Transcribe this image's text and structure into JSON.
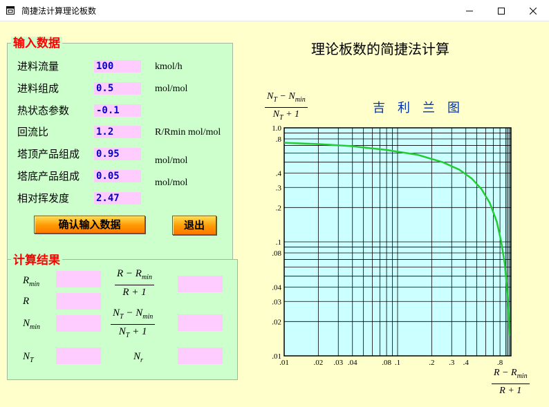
{
  "window": {
    "title": "简捷法计算理论板数"
  },
  "input_frame": {
    "title": "输入数据",
    "rows": [
      {
        "label": "进料流量",
        "value": "100",
        "unit": "kmol/h"
      },
      {
        "label": "进料组成",
        "value": "0.5",
        "unit": "mol/mol"
      },
      {
        "label": "热状态参数",
        "value": "-0.1",
        "unit": ""
      },
      {
        "label": "回流比",
        "value": "1.2",
        "unit": "R/Rmin mol/mol"
      },
      {
        "label": "塔顶产品组成",
        "value": "0.95",
        "unit": "mol/mol"
      },
      {
        "label": "塔底产品组成",
        "value": "0.05",
        "unit": "mol/mol"
      },
      {
        "label": "相对挥发度",
        "value": "2.47",
        "unit": ""
      }
    ],
    "confirm_label": "确认输入数据",
    "exit_label": "退出"
  },
  "result_frame": {
    "title": "计算结果",
    "labels": {
      "rmin": "R",
      "rmin_sub": "min",
      "r": "R",
      "nmin": "N",
      "nmin_sub": "min",
      "nt": "N",
      "nt_sub": "T",
      "nr": "N",
      "nr_sub": "r"
    },
    "frac1": {
      "num": "R − R",
      "num_sub": "min",
      "den": "R + 1"
    },
    "frac2": {
      "num_a": "N",
      "num_a_sub": "T",
      "num_b": " − N",
      "num_b_sub": "min",
      "den_a": "N",
      "den_a_sub": "T",
      "den_b": " + 1"
    }
  },
  "chart_data": {
    "type": "line",
    "title": "理论板数的简捷法计算",
    "subtitle": "吉利兰图",
    "ylabel": {
      "num_a": "N",
      "num_a_sub": "T",
      "num_b": " − N",
      "num_b_sub": "min",
      "den_a": "N",
      "den_a_sub": "T",
      "den_b": " + 1"
    },
    "xlabel": {
      "num": "R − R",
      "num_sub": "min",
      "den": "R + 1"
    },
    "xscale": "log",
    "yscale": "log",
    "xlim": [
      0.01,
      1.0
    ],
    "ylim": [
      0.01,
      1.0
    ],
    "x_tick_labels": [
      ".01",
      ".02",
      ".03",
      ".04",
      ".08",
      ".1",
      ".2",
      ".3",
      ".4",
      ".8"
    ],
    "x_tick_values": [
      0.01,
      0.02,
      0.03,
      0.04,
      0.08,
      0.1,
      0.2,
      0.3,
      0.4,
      0.8
    ],
    "y_tick_labels": [
      "1.0",
      ".8",
      ".4",
      ".3",
      ".2",
      ".1",
      ".08",
      ".04",
      ".03",
      ".02",
      ".01"
    ],
    "y_tick_values": [
      1.0,
      0.8,
      0.4,
      0.3,
      0.2,
      0.1,
      0.08,
      0.04,
      0.03,
      0.02,
      0.01
    ],
    "grid": true,
    "series": [
      {
        "color": "#22cc33",
        "x": [
          0.01,
          0.02,
          0.04,
          0.08,
          0.15,
          0.25,
          0.35,
          0.45,
          0.55,
          0.65,
          0.75,
          0.82,
          0.88,
          0.92,
          0.95,
          0.97
        ],
        "y": [
          0.74,
          0.72,
          0.69,
          0.64,
          0.58,
          0.5,
          0.43,
          0.36,
          0.29,
          0.22,
          0.15,
          0.1,
          0.065,
          0.04,
          0.025,
          0.015
        ]
      }
    ]
  },
  "colors": {
    "background": "#ffffcc",
    "frame_bg": "#ccffcc",
    "frame_title": "#ff0000",
    "input_bg": "#ffccff",
    "input_text": "#0000cc",
    "plot_bg": "#ccffff",
    "curve": "#22cc33"
  },
  "icons": {
    "app": "app-window-icon",
    "minimize": "minimize-icon",
    "maximize": "maximize-icon",
    "close": "close-icon"
  }
}
